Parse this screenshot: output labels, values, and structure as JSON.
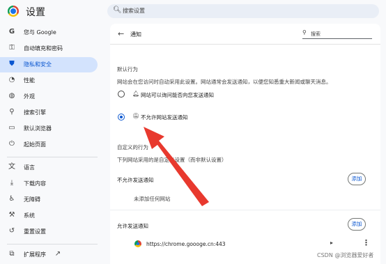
{
  "app": {
    "title": "设置"
  },
  "search": {
    "placeholder": "搜索设置"
  },
  "sidebar": {
    "items": [
      {
        "label": "您与 Google",
        "icon": "google-icon"
      },
      {
        "label": "自动填充和密码",
        "icon": "key-icon"
      },
      {
        "label": "隐私和安全",
        "icon": "shield-icon",
        "active": true
      },
      {
        "label": "性能",
        "icon": "speedometer-icon"
      },
      {
        "label": "外观",
        "icon": "palette-icon"
      },
      {
        "label": "搜索引擎",
        "icon": "search-icon"
      },
      {
        "label": "默认浏览器",
        "icon": "browser-window-icon"
      },
      {
        "label": "起始页面",
        "icon": "power-icon"
      },
      {
        "label": "语言",
        "icon": "translate-icon"
      },
      {
        "label": "下载内容",
        "icon": "download-icon"
      },
      {
        "label": "无障碍",
        "icon": "accessibility-icon"
      },
      {
        "label": "系统",
        "icon": "wrench-icon"
      },
      {
        "label": "重置设置",
        "icon": "reset-icon"
      },
      {
        "label": "扩展程序",
        "icon": "extension-icon",
        "external_icon": "external-link-icon"
      }
    ]
  },
  "main": {
    "title": "通知",
    "search_placeholder": "搜索",
    "default_behavior": {
      "heading": "默认行为",
      "description": "网站会在您访问时自动采用此设置。网站通常会发送通知，以便您知悉重大新闻或聊天消息。",
      "options": [
        {
          "label": "网站可以询问能否向您发送通知",
          "icon": "bell-icon",
          "checked": false
        },
        {
          "label": "不允许网站发送通知",
          "icon": "bell-off-icon",
          "checked": true
        }
      ]
    },
    "custom_behavior": {
      "heading": "自定义的行为",
      "description": "下列网站采用的是自定义设置（而非默认设置）"
    },
    "blocked": {
      "label": "不允许发送通知",
      "add_label": "添加",
      "empty_text": "未添加任何网站"
    },
    "allowed": {
      "label": "允许发送通知",
      "add_label": "添加",
      "sites": [
        {
          "url": "https://chrome.goooge.cn:443"
        }
      ]
    }
  },
  "watermark": "CSDN @浏览器爱好者",
  "colors": {
    "accent": "#0b57d0",
    "active_bg": "#d3e3fd",
    "annotation_arrow": "#e8392e"
  }
}
